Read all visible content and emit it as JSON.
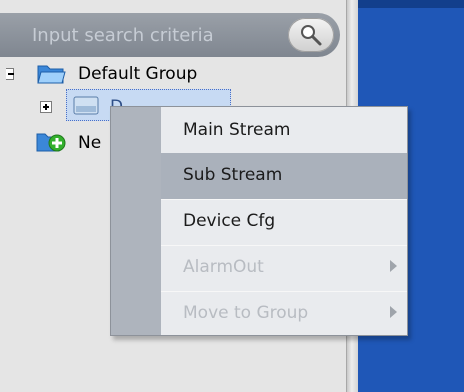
{
  "search": {
    "placeholder": "Input search criteria",
    "icon": "magnifier-icon"
  },
  "tree": {
    "default_group": {
      "label": "Default Group",
      "icon": "open-folder-icon"
    },
    "device": {
      "label": "D",
      "icon": "device-icon",
      "expander": "+"
    },
    "new_group": {
      "label": "Ne",
      "icon": "add-group-icon"
    }
  },
  "context_menu": {
    "items": [
      {
        "label": "Main Stream",
        "enabled": true
      },
      {
        "label": "Sub Stream",
        "enabled": true,
        "highlighted": true
      },
      {
        "label": "Device Cfg",
        "enabled": true
      },
      {
        "label": "AlarmOut",
        "enabled": false,
        "submenu": true
      },
      {
        "label": "Move to Group",
        "enabled": false,
        "submenu": true
      }
    ]
  },
  "colors": {
    "right_area": "#1f57b7",
    "menu_highlight": "#aab1bb",
    "search_bar": "#8a909a"
  }
}
